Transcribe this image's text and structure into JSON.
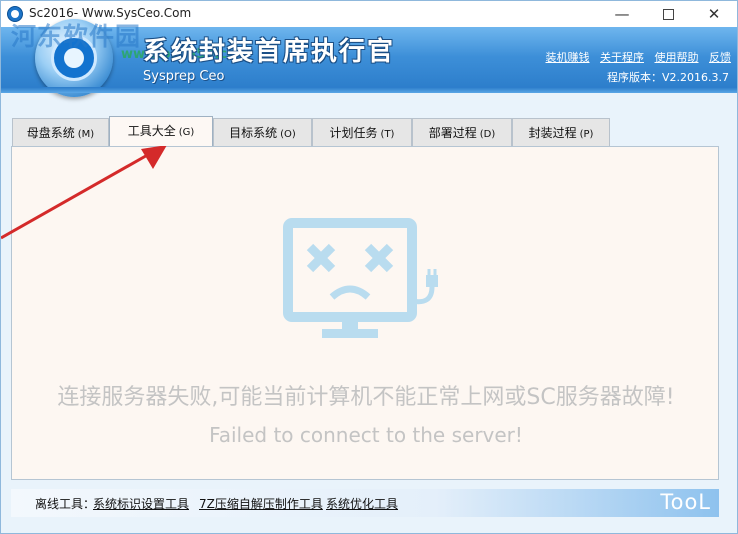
{
  "window": {
    "title": "Sc2016- Www.SysCeo.Com",
    "min_glyph": "—",
    "close_glyph": "✕"
  },
  "header": {
    "watermark": "河东软件园",
    "watermark_url": "www.pc0359.cn",
    "brand_cn": "系统封装首席执行官",
    "brand_en": "Sysprep Ceo",
    "links": [
      "装机赚钱",
      "关于程序",
      "使用帮助",
      "反馈"
    ],
    "version": "程序版本：V2.2016.3.7"
  },
  "tabs": [
    {
      "label": "母盘系统",
      "key": "(M)"
    },
    {
      "label": "工具大全",
      "key": "(G)"
    },
    {
      "label": "目标系统",
      "key": "(O)"
    },
    {
      "label": "计划任务",
      "key": "(T)"
    },
    {
      "label": "部署过程",
      "key": "(D)"
    },
    {
      "label": "封装过程",
      "key": "(P)"
    }
  ],
  "active_tab": 1,
  "panel": {
    "error_cn": "连接服务器失败,可能当前计算机不能正常上网或SC服务器故障!",
    "error_en": "Failed to connect to the server!"
  },
  "bottom": {
    "label": "离线工具：",
    "tools": [
      "系统标识设置工具",
      "7Z压缩自解压制作工具",
      "系统优化工具"
    ],
    "brand": "TooL"
  },
  "colors": {
    "header_blue": "#3d8fd8",
    "error_icon": "#b9dcef",
    "arrow_red": "#d42a2a",
    "error_text": "#c4c4c4"
  }
}
